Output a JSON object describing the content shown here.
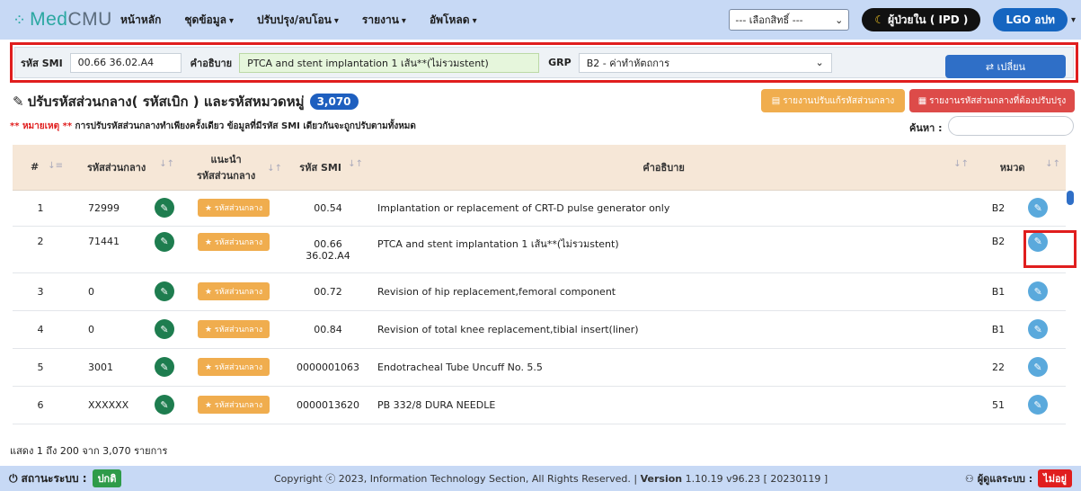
{
  "brand": {
    "icon": "dots-logo-icon",
    "name_a": "Med",
    "name_b": "CMU"
  },
  "nav": {
    "home": "หน้าหลัก",
    "dataset": "ชุดข้อมูล",
    "adjust": "ปรับปรุง/ลบโอน",
    "report": "รายงาน",
    "upload": "อัพโหลด",
    "caret": "▾"
  },
  "rights_select": {
    "value": "--- เลือกสิทธิ์ ---",
    "arrow": "⌄"
  },
  "patient_mode": {
    "icon": "moon-icon",
    "label": "ผู้ป่วยใน ( IPD )"
  },
  "user_menu": {
    "label": "LGO อปท"
  },
  "form": {
    "smi_label": "รหัส SMI",
    "smi_value": "00.66 36.02.A4",
    "desc_label": "คำอธิบาย",
    "desc_value": "PTCA and stent implantation 1 เส้น**(ไม่รวมstent)",
    "grp_label": "GRP",
    "grp_value": "B2 - ค่าทำหัตถการ",
    "change_button": "⇄ เปลี่ยน"
  },
  "title": {
    "text": "ปรับรหัสส่วนกลาง( รหัสเบิก ) และรหัสหมวดหมู่",
    "count": "3,070"
  },
  "buttons": {
    "report_adjusted": "รายงานปรับแก้รหัสส่วนกลาง",
    "report_needed": "รายงานรหัสส่วนกลางที่ต้องปรับปรุง"
  },
  "note": {
    "prefix": "** หมายเหตุ **",
    "text": " การปรับรหัสส่วนกลางทำเพียงครั้งเดียว ข้อมูลที่มีรหัส SMI เดียวกันจะถูกปรับตามทั้งหมด"
  },
  "search": {
    "label": "ค้นหา :",
    "value": ""
  },
  "table": {
    "headers": {
      "num": "#",
      "central": "รหัสส่วนกลาง",
      "suggest_line1": "แนะนำ",
      "suggest_line2": "รหัสส่วนกลาง",
      "smi": "รหัส SMI",
      "desc": "คำอธิบาย",
      "category": "หมวด"
    },
    "suggest_label": "★ รหัสส่วนกลาง",
    "rows": [
      {
        "num": "1",
        "central": "72999",
        "smi": "00.54",
        "smi2": "",
        "desc": "Implantation or replacement of CRT-D pulse generator only",
        "cat": "B2"
      },
      {
        "num": "2",
        "central": "71441",
        "smi": "00.66",
        "smi2": "36.02.A4",
        "desc": "PTCA and stent implantation 1 เส้น**(ไม่รวมstent)",
        "cat": "B2"
      },
      {
        "num": "3",
        "central": "0",
        "smi": "00.72",
        "smi2": "",
        "desc": "Revision of hip replacement,femoral component",
        "cat": "B1"
      },
      {
        "num": "4",
        "central": "0",
        "smi": "00.84",
        "smi2": "",
        "desc": "Revision of total knee replacement,tibial insert(liner)",
        "cat": "B1"
      },
      {
        "num": "5",
        "central": "3001",
        "smi": "0000001063",
        "smi2": "",
        "desc": "Endotracheal Tube Uncuff No. 5.5",
        "cat": "22"
      },
      {
        "num": "6",
        "central": "XXXXXX",
        "smi": "0000013620",
        "smi2": "",
        "desc": "PB 332/8 DURA NEEDLE",
        "cat": "51"
      }
    ]
  },
  "pagination": {
    "info": "แสดง 1 ถึง 200 จาก 3,070 รายการ"
  },
  "footer": {
    "status_label": "สถานะระบบ :",
    "status_value": "ปกติ",
    "copyright": "Copyright ⓒ 2023, Information Technology Section, All Rights Reserved. | ",
    "version_label": "Version",
    "version_value": " 1.10.19 v96.23 [ 20230119 ]",
    "admin_label": "ผู้ดูแลระบบ :",
    "admin_value": "ไม่อยู่"
  }
}
